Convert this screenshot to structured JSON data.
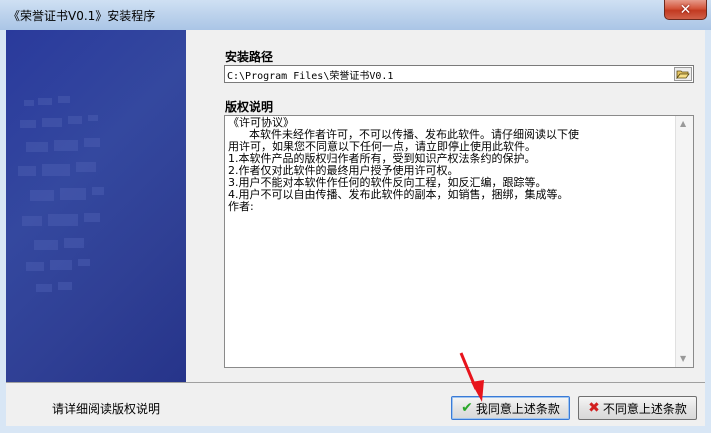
{
  "window": {
    "title": "《荣誉证书V0.1》安装程序",
    "close_icon": "close-icon"
  },
  "install_path": {
    "label": "安装路径",
    "value": "C:\\Program Files\\荣誉证书V0.1"
  },
  "license": {
    "label": "版权说明",
    "text": "《许可协议》\n      本软件未经作者许可，不可以传播、发布此软件。请仔细阅读以下使\n用许可，如果您不同意以下任何一点，请立即停止使用此软件。\n1.本软件产品的版权归作者所有，受到知识产权法条约的保护。\n2.作者仅对此软件的最终用户授予使用许可权。\n3.用户不能对本软件作任何的软件反向工程，如反汇编，跟踪等。\n4.用户不可以自由传播、发布此软件的副本，如销售，捆绑，集成等。\n作者:"
  },
  "footer": {
    "hint": "请详细阅读版权说明",
    "agree_label": "我同意上述条款",
    "disagree_label": "不同意上述条款"
  },
  "colors": {
    "agree_icon": "#2aa82a",
    "disagree_icon": "#d21f1f",
    "annotation_arrow": "#e8141c"
  }
}
